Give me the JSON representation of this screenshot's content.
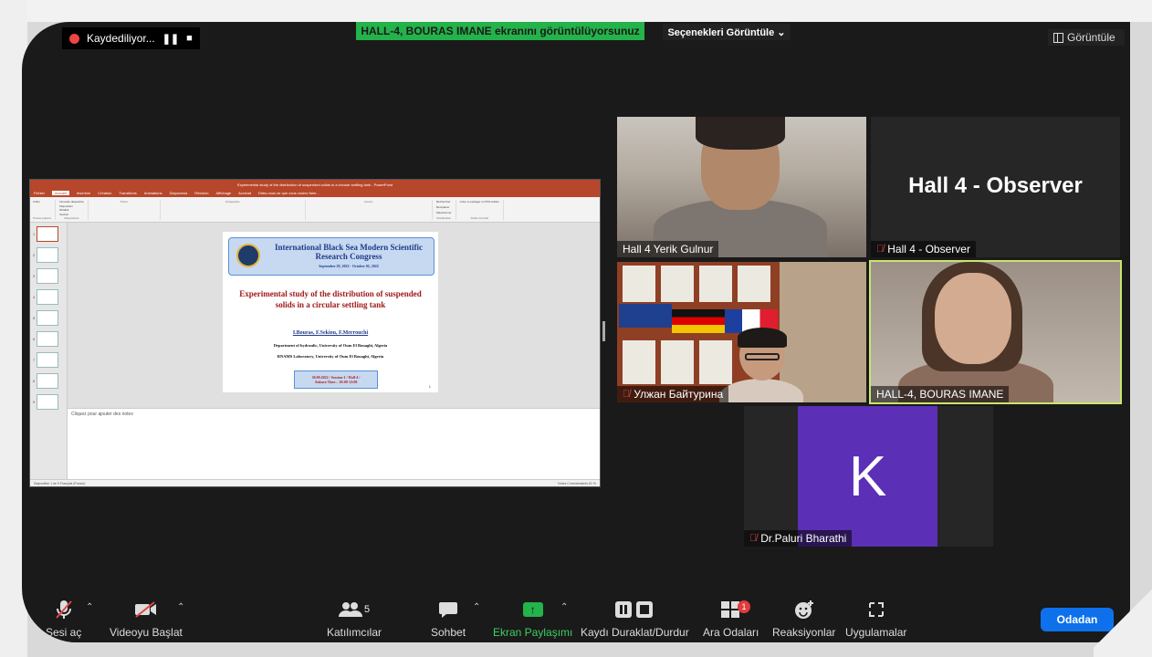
{
  "recording": {
    "label": "Kaydediliyor...",
    "pause": "❚❚",
    "stop": "■"
  },
  "share_banner": "HALL-4, BOURAS IMANE ekranını görüntülüyorsunuz",
  "view_options": "Seçenekleri Görüntüle ⌄",
  "view_button": "Görüntüle",
  "ppt": {
    "window_title": "Experimental study of the distribution of suspended solids in a circular settling tank - PowerPoint",
    "tabs": [
      "Fichier",
      "Accueil",
      "Insertion",
      "Création",
      "Transitions",
      "Animations",
      "Diaporama",
      "Révision",
      "Affichage",
      "Acrobat",
      "Dites-nous ce que vous voulez faire..."
    ],
    "ribbon_groups": [
      "Presse-papiers",
      "Diapositives",
      "Police",
      "Paragraphe",
      "Dessin",
      "Modification",
      "Adobe Acrobat"
    ],
    "ribbon_buttons": [
      "Coller",
      "Nouvelle diapositive",
      "Disposition",
      "Rétablir",
      "Section",
      "Rechercher",
      "Remplacer",
      "Sélectionner",
      "Créer et partager un PDF Adobe"
    ],
    "thumbs": [
      "1",
      "2",
      "3",
      "4",
      "5",
      "6",
      "7",
      "8",
      "9"
    ],
    "slide": {
      "congress": "International Black Sea Modern Scientific Research Congress",
      "dates": "September 29, 2022 - October 02, 2022",
      "title": "Experimental study of the distribution of suspended solids in a circular settling tank",
      "authors": "I.Bouras, F.Sekiou, F.Merrouchi",
      "affiliation1": "Department of hydraulic, University of Oum El Bouaghi, Algeria",
      "affiliation2": "RNAMS Laboratory, University of Oum El Bouaghi, Algeria",
      "session_line1": "30.09.2022 / Session-1 / Hall-4 /",
      "session_line2": "Ankara Time – 10:00-12:00",
      "page_num": "1"
    },
    "notes_placeholder": "Cliquez pour ajouter des notes",
    "status_left": "Diapositive 1 de 9   Français (France)",
    "status_right": "Notes   Commentaires   61 %"
  },
  "participants": {
    "p1": {
      "name": "Hall 4 Yerik Gulnur"
    },
    "p2": {
      "name": "Hall 4 - Observer",
      "display_text": "Hall 4 - Observer"
    },
    "p3": {
      "name": "Улжан Байтурина"
    },
    "p4": {
      "name": "HALL-4, BOURAS IMANE"
    },
    "p5": {
      "name": "Dr.Paluri Bharathi",
      "initial": "K"
    }
  },
  "toolbar": {
    "audio": "Sesi aç",
    "video": "Videoyu Başlat",
    "participants_label": "Katılımcılar",
    "participants_count": "5",
    "chat": "Sohbet",
    "share": "Ekran Paylaşımı",
    "recording": "Kaydı Duraklat/Durdur",
    "breakout": "Ara Odaları",
    "breakout_badge": "1",
    "reactions": "Reaksiyonlar",
    "apps": "Uygulamalar",
    "end": "Odadan"
  },
  "colors": {
    "share_green": "#24b24b",
    "active_speaker": "#c8e66e",
    "avatar_purple": "#5b2fb6",
    "ppt_red": "#b7472a",
    "end_blue": "#0e71eb"
  }
}
